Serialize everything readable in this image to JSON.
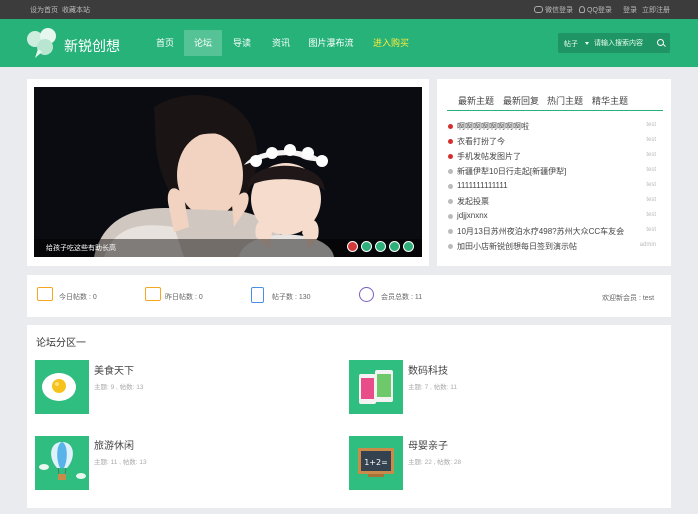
{
  "topbar": {
    "set_home": "设为首页",
    "bookmark": "收藏本站",
    "wechat_login": "微信登录",
    "qq_login": "QQ登录",
    "login": "登录",
    "register": "立即注册"
  },
  "header": {
    "logo_text": "新锐创想",
    "nav": [
      "首页",
      "论坛",
      "导读",
      "资讯",
      "图片瀑布流",
      "进入购买"
    ],
    "active_nav": "论坛",
    "search": {
      "scope": "帖子",
      "placeholder": "请输入搜索内容"
    }
  },
  "slider": {
    "caption": "给孩子吃这些有助长高",
    "slide_count": 5,
    "active_slide": 1
  },
  "topics": {
    "tabs": [
      "最新主题",
      "最新回复",
      "热门主题",
      "精华主题"
    ],
    "items": [
      {
        "title": "啊啊啊啊啊啊啊啊啦",
        "author": "test",
        "hot": true
      },
      {
        "title": "衣看打扮了今",
        "author": "test",
        "hot": true
      },
      {
        "title": "手机发帖发图片了",
        "author": "test",
        "hot": true
      },
      {
        "title": "新疆伊犁10日行走起[新疆伊犁]",
        "author": "test",
        "hot": false
      },
      {
        "title": "1111111111111",
        "author": "test",
        "hot": false
      },
      {
        "title": "发起投票",
        "author": "test",
        "hot": false
      },
      {
        "title": "jdjjxnxnx",
        "author": "test",
        "hot": false
      },
      {
        "title": "10月13日苏州夜泊水疗498?苏州大众CC车友会",
        "author": "test",
        "hot": false
      },
      {
        "title": "加田小店新锐创想每日签到演示帖",
        "author": "admin",
        "hot": false
      }
    ]
  },
  "stats": {
    "today": "今日帖数 : 0",
    "yesterday": "昨日帖数 : 0",
    "posts": "帖子数 : 130",
    "members": "会员总数 : 11",
    "welcome": "欢迎新会员 : test"
  },
  "section": {
    "title": "论坛分区一",
    "forums": [
      {
        "name": "美食天下",
        "meta": "主题: 9 , 帖数: 13",
        "icon": "fried-egg-icon"
      },
      {
        "name": "数码科技",
        "meta": "主题: 7 , 帖数: 11",
        "icon": "smartphones-icon"
      },
      {
        "name": "旅游休闲",
        "meta": "主题: 11 , 帖数: 13",
        "icon": "hot-air-balloon-icon"
      },
      {
        "name": "母婴亲子",
        "meta": "主题: 22 , 帖数: 28",
        "icon": "chalkboard-icon"
      }
    ],
    "chalkboard_text": "1+2="
  },
  "colors": {
    "brand": "#27b27a",
    "hot": "#ffea3c",
    "bullet_hot": "#d42f2f"
  }
}
